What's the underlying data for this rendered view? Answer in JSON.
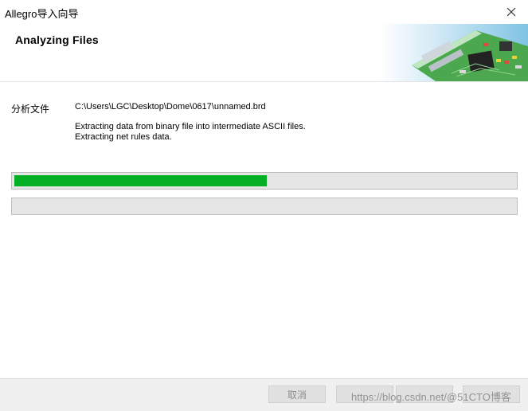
{
  "window": {
    "title": "Allegro导入向导"
  },
  "header": {
    "heading": "Analyzing Files"
  },
  "content": {
    "file_label": "分析文件",
    "file_path": "C:\\Users\\LGC\\Desktop\\Dome\\0617\\unnamed.brd",
    "status_lines": [
      "Extracting data from binary file into intermediate ASCII files.",
      "Extracting net rules data."
    ],
    "progress_overall": 0.505,
    "progress_step": 0.0
  },
  "footer": {
    "cancel_label": "取消",
    "back_label": "",
    "next_label": "",
    "finish_label": "",
    "watermark": "https://blog.csdn.net/@51CTO博客"
  },
  "colors": {
    "progress_fill": "#06b025",
    "track": "#e6e6e6"
  }
}
